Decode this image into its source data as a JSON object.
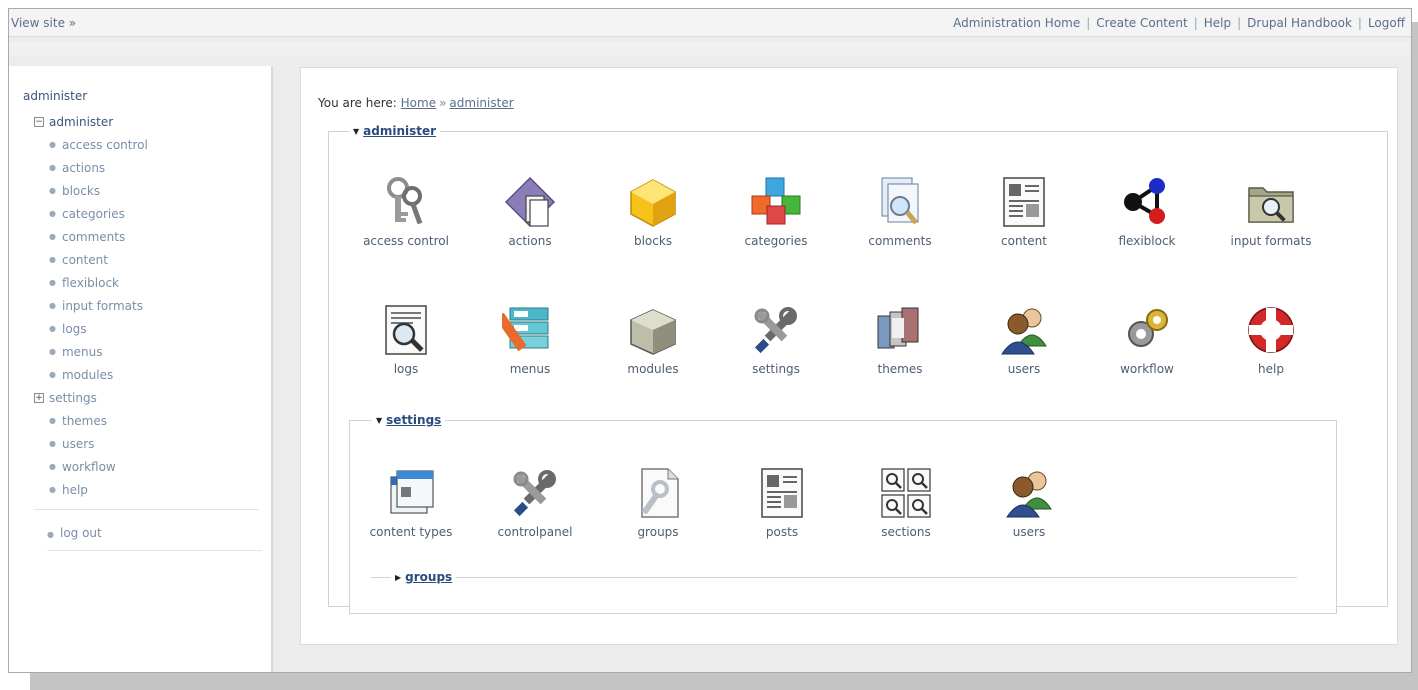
{
  "topbar": {
    "view_site": "View site »",
    "links": [
      "Administration Home",
      "Create Content",
      "Help",
      "Drupal Handbook",
      "Logoff"
    ]
  },
  "sidebar": {
    "title": "administer",
    "root": "administer",
    "items": [
      "access control",
      "actions",
      "blocks",
      "categories",
      "comments",
      "content",
      "flexiblock",
      "input formats",
      "logs",
      "menus",
      "modules",
      "settings",
      "themes",
      "users",
      "workflow",
      "help"
    ],
    "logout": "log out"
  },
  "breadcrumb": {
    "prefix": "You are here:",
    "home": "Home",
    "separator": "»",
    "current": "administer"
  },
  "administer": {
    "legend": "administer",
    "row1": [
      "access control",
      "actions",
      "blocks",
      "categories",
      "comments",
      "content",
      "flexiblock",
      "input formats"
    ],
    "row2": [
      "logs",
      "menus",
      "modules",
      "settings",
      "themes",
      "users",
      "workflow",
      "help"
    ]
  },
  "settings": {
    "legend": "settings",
    "items": [
      "content types",
      "controlpanel",
      "groups",
      "posts",
      "sections",
      "users"
    ]
  },
  "groups": {
    "legend": "groups"
  },
  "icons": {
    "access control": "keys-icon",
    "actions": "actions-icon",
    "blocks": "blocks-icon",
    "categories": "categories-icon",
    "comments": "comments-icon",
    "content": "content-icon",
    "flexiblock": "flexiblock-icon",
    "input formats": "input-formats-icon",
    "logs": "logs-icon",
    "menus": "menus-icon",
    "modules": "modules-icon",
    "settings": "settings-icon",
    "themes": "themes-icon",
    "users": "users-icon",
    "workflow": "workflow-icon",
    "help": "help-icon",
    "content types": "content-types-icon",
    "controlpanel": "controlpanel-icon",
    "groups": "groups-icon",
    "posts": "posts-icon",
    "sections": "sections-icon"
  },
  "colors": {
    "link": "#5a6f8e",
    "legend": "#2b4c7e",
    "sidebar_link": "#7a8ea8"
  }
}
